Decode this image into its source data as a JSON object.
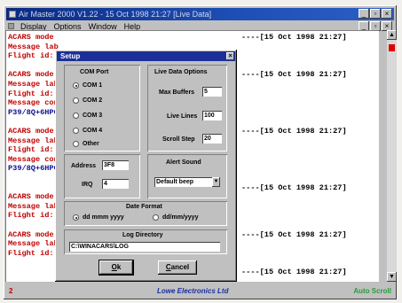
{
  "window": {
    "title": "Air Master 2000 V1.22 - 15 Oct 1998 21:27 [Live Data]",
    "controls": [
      "_",
      "▫",
      "×"
    ]
  },
  "menu": {
    "items": [
      "Display",
      "Options",
      "Window",
      "Help"
    ],
    "mdi_controls": [
      "_",
      "▫",
      "×"
    ]
  },
  "log": {
    "lines": [
      {
        "text": "ACARS mode",
        "color": "red",
        "stamp": "----[15 Oct 1998 21:27]"
      },
      {
        "text": "Message lab",
        "color": "red"
      },
      {
        "text": "Flight id:",
        "color": "red"
      },
      {
        "text": "",
        "color": "red"
      },
      {
        "text": "ACARS mode",
        "color": "red",
        "stamp": "----[15 Oct 1998 21:27]"
      },
      {
        "text": "Message lab",
        "color": "red"
      },
      {
        "text": "Flight id:",
        "color": "red"
      },
      {
        "text": "Message con",
        "color": "red"
      },
      {
        "text": "P39/8Q+6HPC",
        "color": "blue"
      },
      {
        "text": "",
        "color": "red"
      },
      {
        "text": "ACARS mode",
        "color": "red",
        "stamp": "----[15 Oct 1998 21:27]"
      },
      {
        "text": "Message lab",
        "color": "red"
      },
      {
        "text": "Flight id:",
        "color": "red"
      },
      {
        "text": "Message con",
        "color": "red"
      },
      {
        "text": "P39/8Q+6HPC",
        "color": "blue"
      },
      {
        "text": "",
        "color": "red"
      },
      {
        "text": "",
        "color": "red",
        "stamp": "----[15 Oct 1998 21:27]"
      },
      {
        "text": "ACARS mode",
        "color": "red"
      },
      {
        "text": "Message lab",
        "color": "red"
      },
      {
        "text": "Flight id:",
        "color": "red"
      },
      {
        "text": "",
        "color": "red"
      },
      {
        "text": "ACARS mode",
        "color": "red",
        "stamp": "----[15 Oct 1998 21:27]"
      },
      {
        "text": "Message lab",
        "color": "red"
      },
      {
        "text": "Flight id:",
        "color": "red"
      },
      {
        "text": "",
        "color": "red"
      },
      {
        "text": "",
        "color": "red",
        "stamp": "----[15 Oct 1998 21:27]"
      }
    ]
  },
  "status": {
    "left": "2",
    "center": "Lowe Electronics Ltd",
    "right": "Auto Scroll"
  },
  "setup": {
    "title": "Setup",
    "com_port": {
      "label": "COM Port",
      "options": [
        "COM 1",
        "COM 2",
        "COM 3",
        "COM 4",
        "Other"
      ],
      "selected": "COM 1"
    },
    "live": {
      "label": "Live Data Options",
      "max_buffers_label": "Max Buffers",
      "max_buffers": "5",
      "live_lines_label": "Live Lines",
      "live_lines": "100",
      "scroll_step_label": "Scroll Step",
      "scroll_step": "20"
    },
    "address_label": "Address",
    "address": "3F8",
    "irq_label": "IRQ",
    "irq": "4",
    "alert": {
      "label": "Alert Sound",
      "value": "Default beep"
    },
    "date_format": {
      "label": "Date Format",
      "options": [
        "dd mmm yyyy",
        "dd/mm/yyyy"
      ],
      "selected": "dd mmm yyyy"
    },
    "log_dir": {
      "label": "Log Directory",
      "value": "C:\\WINACARS\\LOG"
    },
    "ok": "Ok",
    "cancel": "Cancel"
  }
}
